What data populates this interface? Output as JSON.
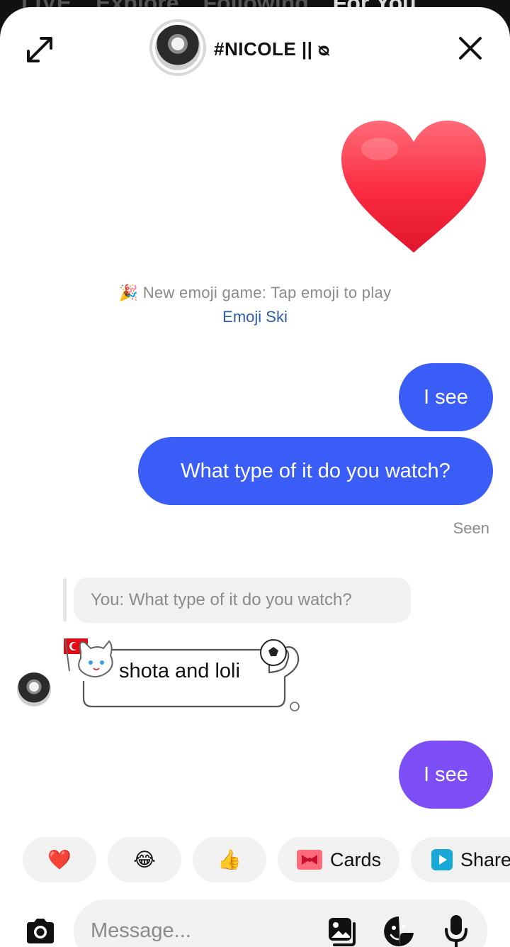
{
  "background_tabs": [
    "LIVE",
    "Explore",
    "Following",
    "For You"
  ],
  "header": {
    "title": "#NICOLE || ᴓ"
  },
  "system_message": {
    "text": "🎉 New emoji game: Tap emoji to play",
    "link": "Emoji Ski"
  },
  "messages": {
    "sent_1": "I see",
    "sent_2": "What type of it do you watch?",
    "status": "Seen",
    "quote": "You: What type of it do you watch?",
    "received_1": "shota and loli",
    "sent_3": "I see"
  },
  "quick_replies": {
    "heart": "❤️",
    "laugh": "😂",
    "thumbs": "👍",
    "cards": "Cards",
    "share": "Share"
  },
  "composer": {
    "placeholder": "Message..."
  },
  "colors": {
    "sent_bubble": "#3a5cf7",
    "sent_bubble_latest": "#7d4ef5",
    "link": "#2a5ca8"
  }
}
